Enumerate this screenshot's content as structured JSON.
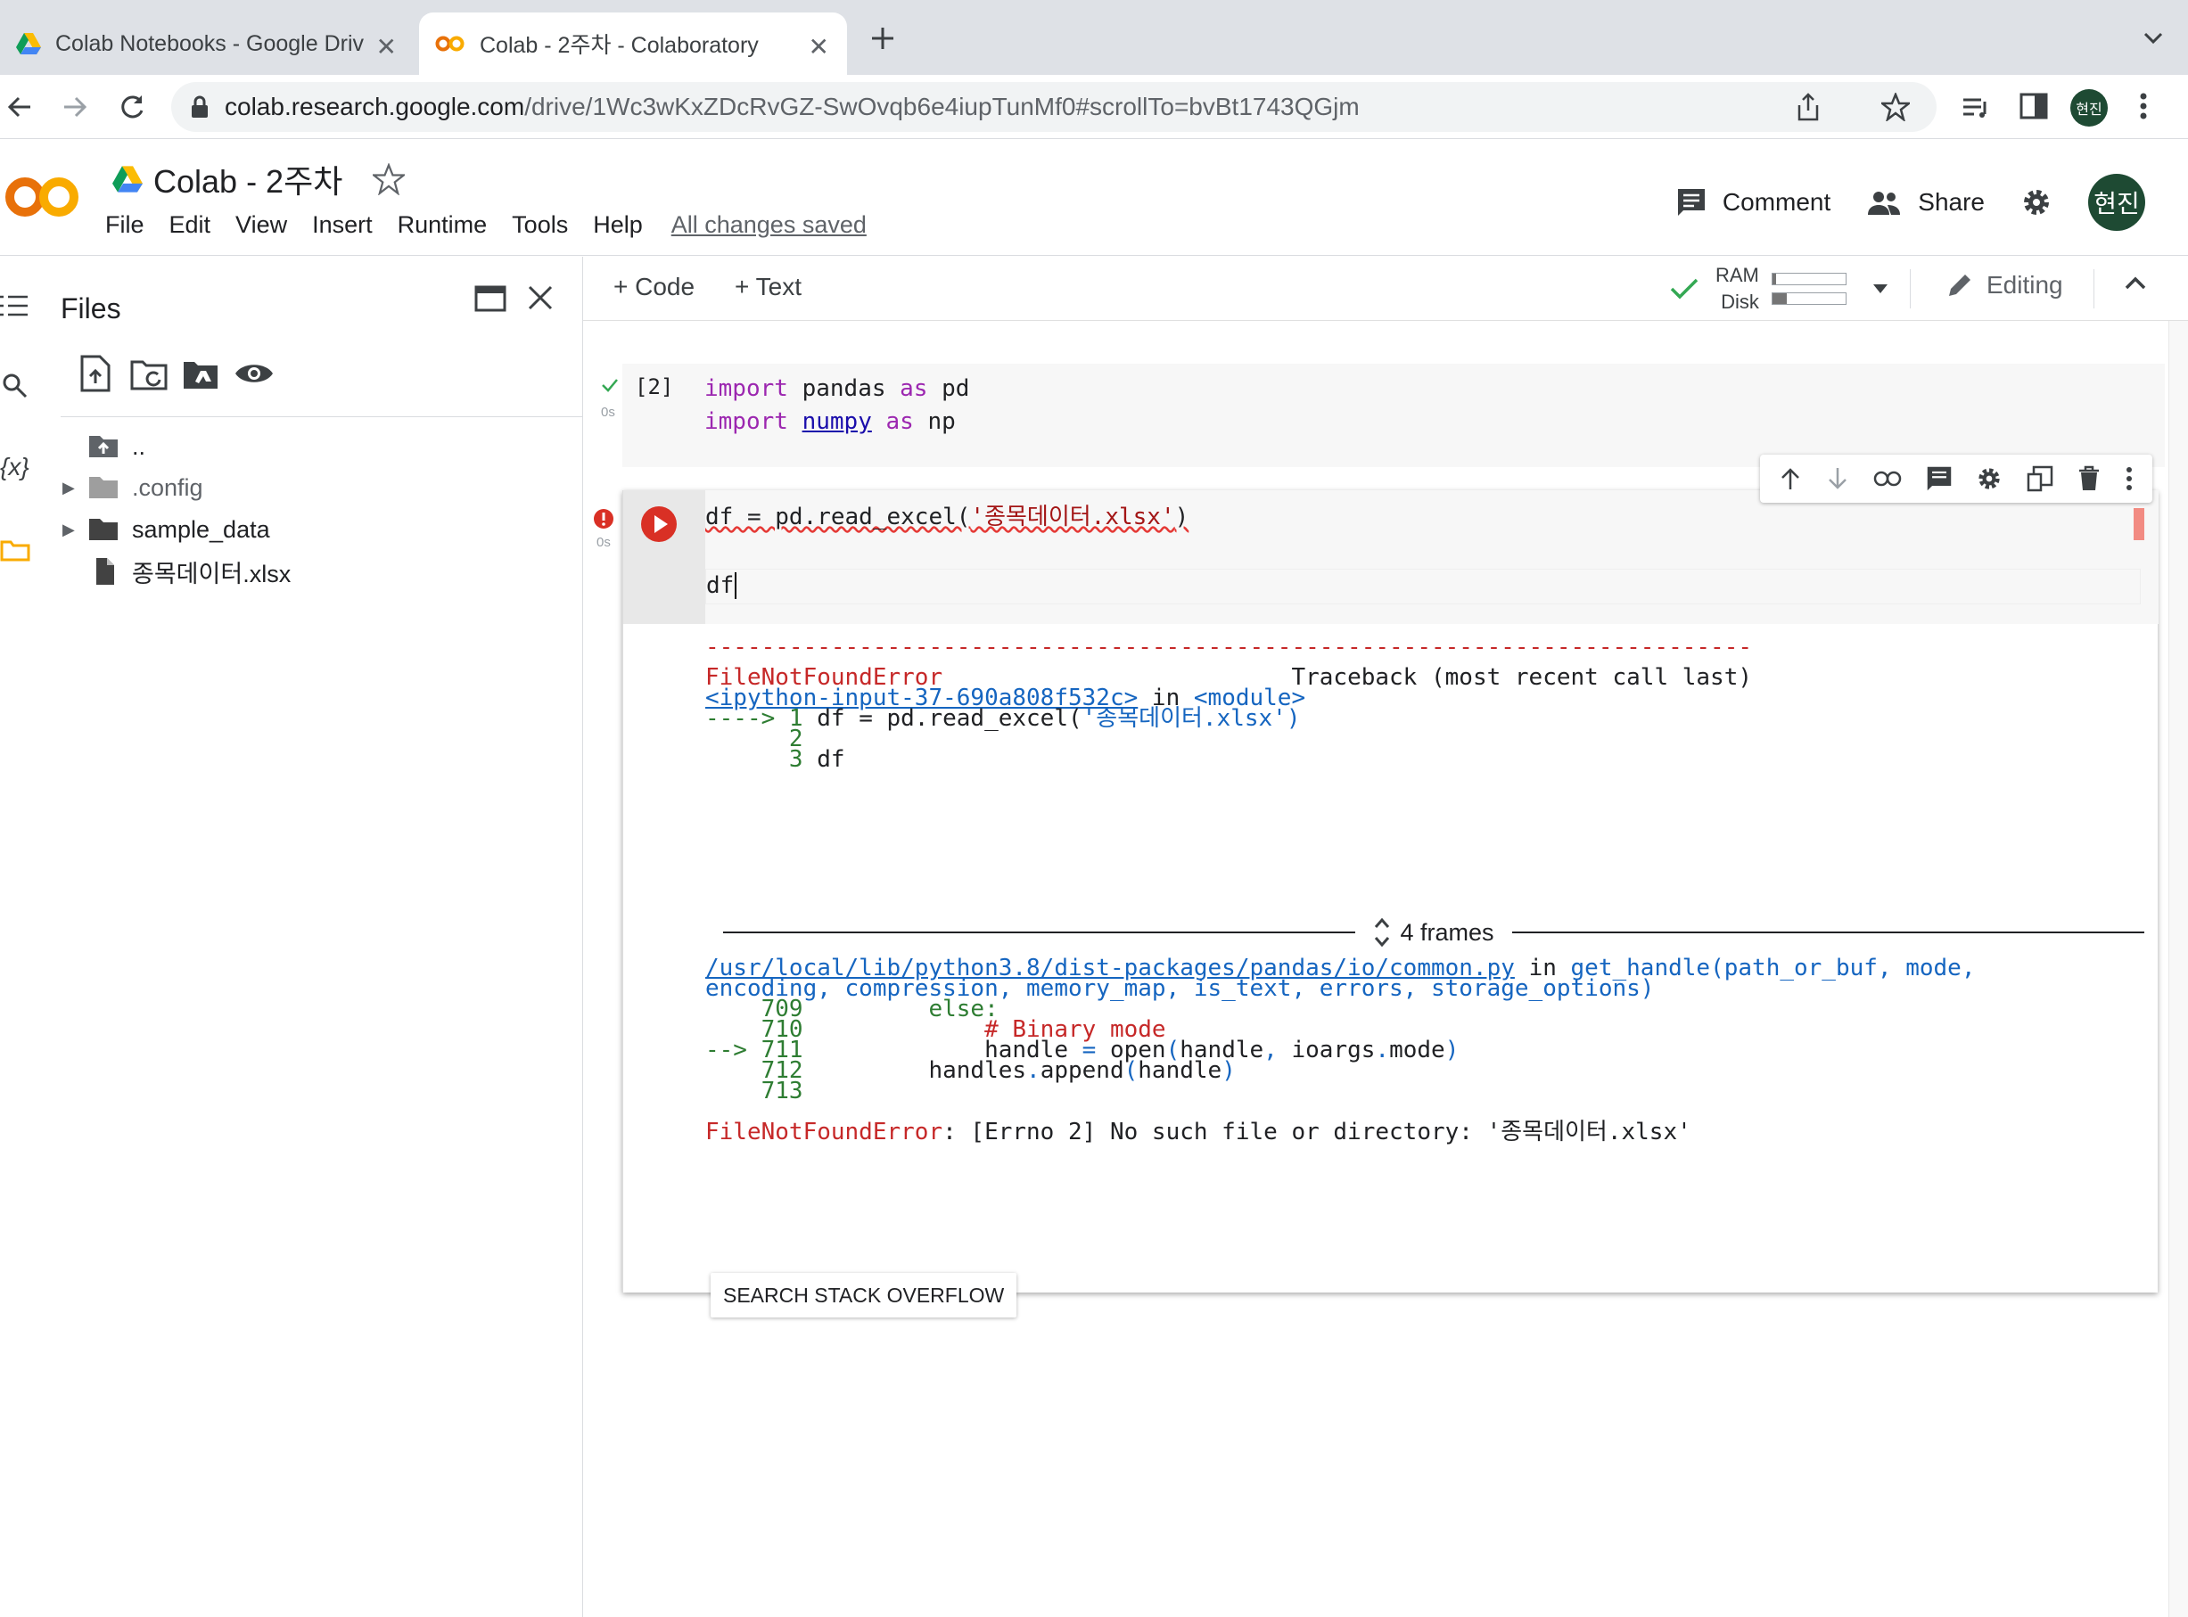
{
  "browser": {
    "tabs": [
      {
        "title": "Colab Notebooks - Google Driv",
        "favicon": "google-drive-icon"
      },
      {
        "title": "Colab - 2주차 - Colaboratory",
        "favicon": "colab-icon"
      }
    ],
    "url_host": "colab.research.google.com",
    "url_path": "/drive/1Wc3wKxZDcRvGZ-SwOvqb6e4iupTunMf0#scrollTo=bvBt1743QGjm",
    "profile_initials": "현진"
  },
  "header": {
    "logo_text": "CO",
    "title": "Colab - 2주차",
    "menu": [
      "File",
      "Edit",
      "View",
      "Insert",
      "Runtime",
      "Tools",
      "Help"
    ],
    "saved_status": "All changes saved",
    "comment_label": "Comment",
    "share_label": "Share",
    "avatar_initials": "현진"
  },
  "sidebar": {
    "title": "Files",
    "tree": [
      {
        "name": "..",
        "type": "parent-folder"
      },
      {
        "name": ".config",
        "type": "folder"
      },
      {
        "name": "sample_data",
        "type": "folder"
      },
      {
        "name": "종목데이터.xlsx",
        "type": "file"
      }
    ]
  },
  "toolbar": {
    "add_code": "Code",
    "add_text": "Text",
    "ram_label": "RAM",
    "disk_label": "Disk",
    "ram_usage": 0.05,
    "disk_usage": 0.2,
    "editing_label": "Editing"
  },
  "cells": {
    "cell1": {
      "exec_count": "[2]",
      "time": "0s",
      "line1_kw": "import",
      "line1_mod": "pandas",
      "line1_as": "as",
      "line1_alias": "pd",
      "line2_kw": "import",
      "line2_mod": "numpy",
      "line2_as": "as",
      "line2_alias": "np"
    },
    "cell2": {
      "time": "0s",
      "code_pre": "df = pd.read_excel(",
      "code_str": "'종목데이터.xlsx'",
      "code_post": ")",
      "code_line2": "df"
    }
  },
  "output": {
    "dashes": "---------------------------------------------------------------------------",
    "err_name": "FileNotFoundError",
    "traceback_label": "Traceback (most recent call last)",
    "input_link": "<ipython-input-37-690a808f532c>",
    "in_word": "in",
    "module": "<module>",
    "arrow1": "----> 1",
    "frame1_code": " df = pd.read_excel(",
    "frame1_str": "'종목데이터.xlsx'",
    "frame1_end": ")",
    "ln2": "      2",
    "ln3": "      3",
    "ln3_code": " df",
    "frames_label": "4 frames",
    "common_path": "/usr/local/lib/python3.8/dist-packages/pandas/io/common.py",
    "get_handle": "get_handle",
    "sig1": "(path_or_buf, mode,",
    "sig2": "encoding, compression, memory_map, is_text, errors, storage_options)",
    "l709": "    709",
    "l709_code": "         else:",
    "l710": "    710",
    "l710_code": "             # Binary mode",
    "l711": "--> 711",
    "l711_a": "             handle ",
    "l711_b": "=",
    "l711_c": " open",
    "l711_d": "(",
    "l711_e": "handle",
    "l711_f": ",",
    "l711_g": " ioargs",
    "l711_h": ".",
    "l711_i": "mode",
    "l711_j": ")",
    "l712": "    712",
    "l712_code": "         handles",
    "l712_b": ".",
    "l712_c": "append",
    "l712_d": "(",
    "l712_e": "handle",
    "l712_f": ")",
    "l713": "    713",
    "final_err": "FileNotFoundError",
    "final_msg": ": [Errno 2] No such file or directory: '종목데이터.xlsx'",
    "so_button": "SEARCH STACK OVERFLOW"
  },
  "colors": {
    "accent": "#f9ab00",
    "error": "#c62828",
    "avatar": "#1e4a33"
  }
}
